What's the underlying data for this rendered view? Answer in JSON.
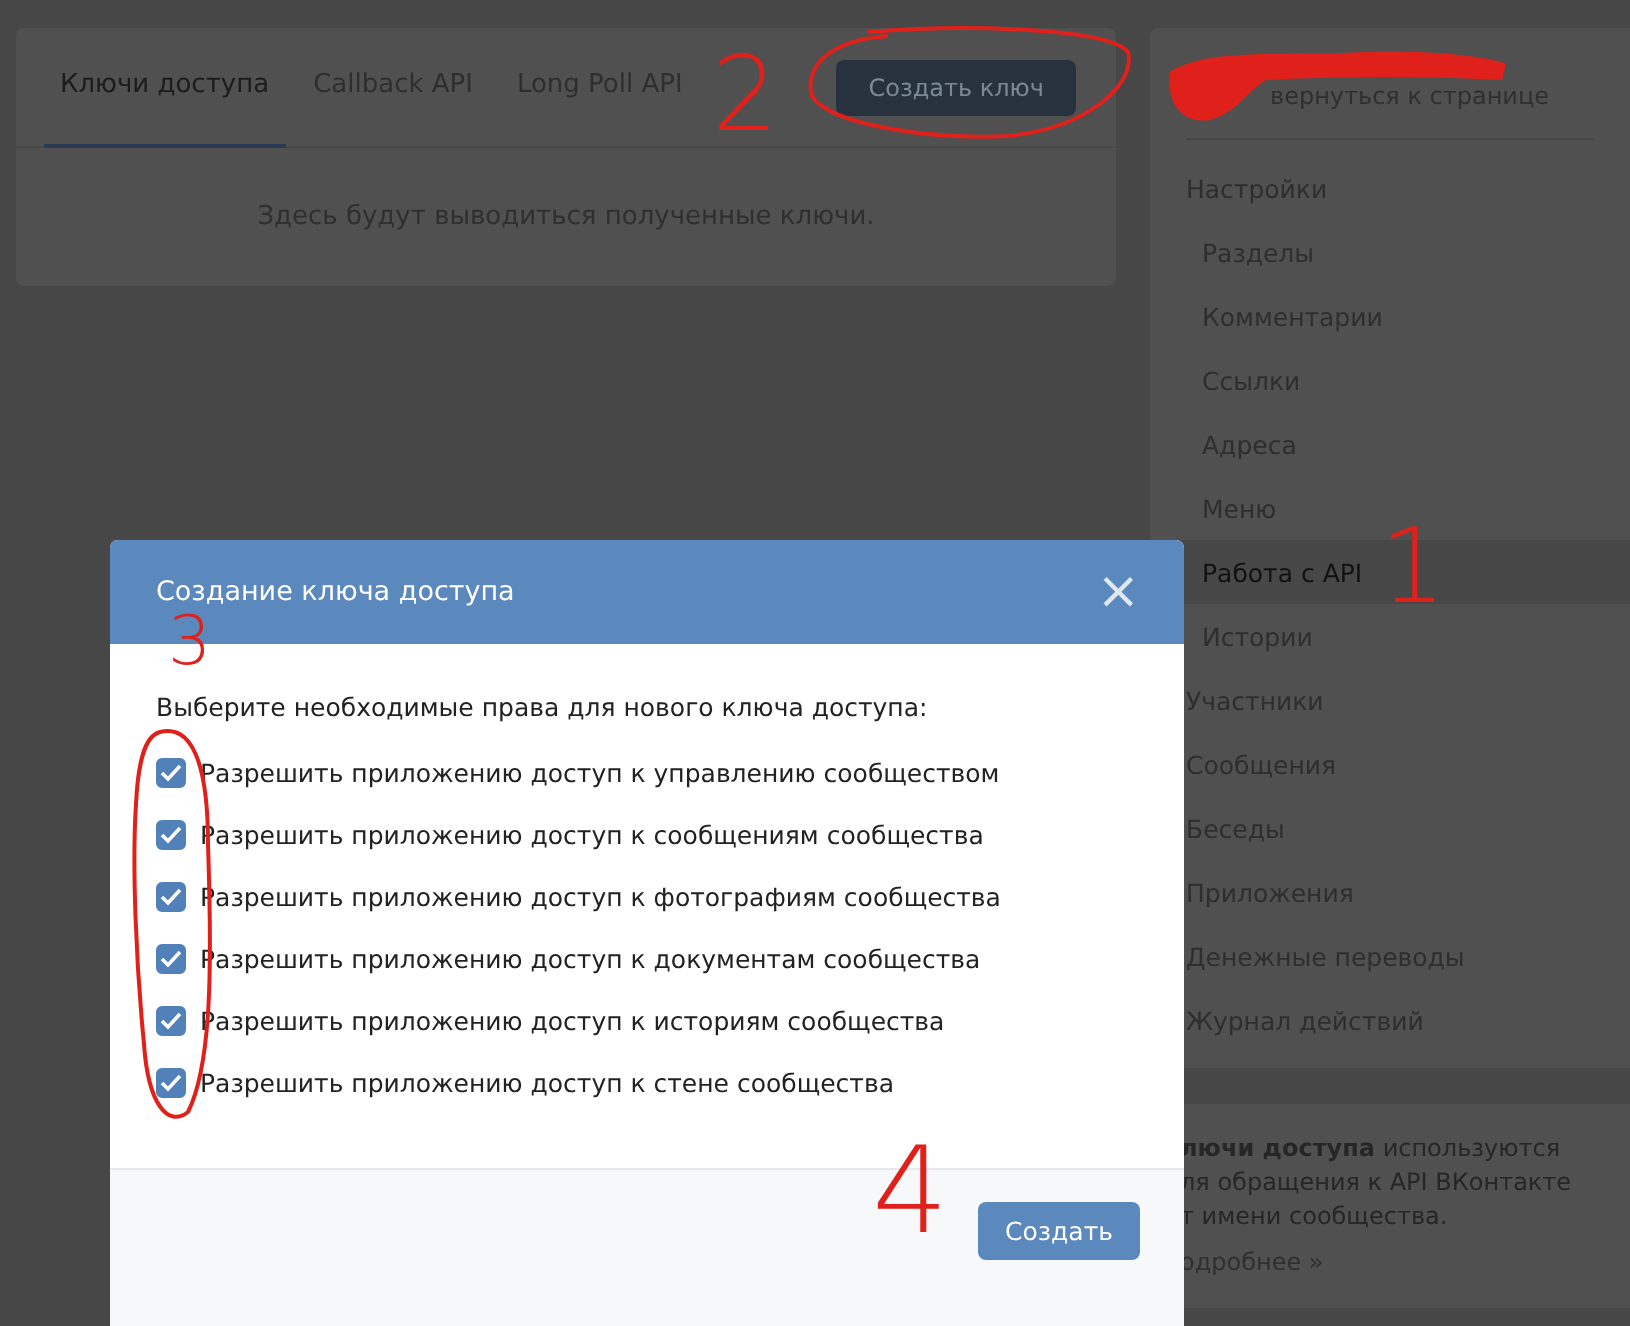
{
  "tabs": [
    {
      "label": "Ключи доступа",
      "selected": true
    },
    {
      "label": "Callback API",
      "selected": false
    },
    {
      "label": "Long Poll API",
      "selected": false
    }
  ],
  "create_key_button": "Создать ключ",
  "empty_text": "Здесь будут выводиться полученные ключи.",
  "sidebar": {
    "back_link": "вернуться к странице",
    "items": [
      {
        "label": "Настройки",
        "selected": false,
        "children": [
          {
            "label": "Разделы",
            "selected": false
          },
          {
            "label": "Комментарии",
            "selected": false
          },
          {
            "label": "Ссылки",
            "selected": false
          },
          {
            "label": "Адреса",
            "selected": false
          },
          {
            "label": "Меню",
            "selected": false
          },
          {
            "label": "Работа с API",
            "selected": true
          },
          {
            "label": "Истории",
            "selected": false
          }
        ]
      },
      {
        "label": "Участники",
        "selected": false
      },
      {
        "label": "Сообщения",
        "selected": false
      },
      {
        "label": "Беседы",
        "selected": false
      },
      {
        "label": "Приложения",
        "selected": false
      },
      {
        "label": "Денежные переводы",
        "selected": false
      },
      {
        "label": "Журнал действий",
        "selected": false
      }
    ]
  },
  "info": {
    "lines": [
      "**лючи доступа** используются",
      "ля обращения к API ВКонтакте",
      "т имени сообщества."
    ],
    "more_link": "одробнее »"
  },
  "dialog": {
    "title": "Создание ключа доступа",
    "close": "×",
    "intro": "Выберите необходимые права для нового ключа доступа:",
    "permissions": [
      {
        "label": "Разрешить приложению доступ к управлению сообществом",
        "checked": true
      },
      {
        "label": "Разрешить приложению доступ к сообщениям сообщества",
        "checked": true
      },
      {
        "label": "Разрешить приложению доступ к фотографиям сообщества",
        "checked": true
      },
      {
        "label": "Разрешить приложению доступ к документам сообщества",
        "checked": true
      },
      {
        "label": "Разрешить приложению доступ к историям сообщества",
        "checked": true
      },
      {
        "label": "Разрешить приложению доступ к стене сообщества",
        "checked": true
      }
    ],
    "submit": "Создать"
  },
  "annotations": [
    {
      "kind": "digit",
      "text": "1"
    },
    {
      "kind": "digit",
      "text": "2"
    },
    {
      "kind": "digit",
      "text": "3"
    },
    {
      "kind": "digit",
      "text": "4"
    },
    {
      "kind": "circle"
    },
    {
      "kind": "oval"
    },
    {
      "kind": "scribble"
    }
  ]
}
